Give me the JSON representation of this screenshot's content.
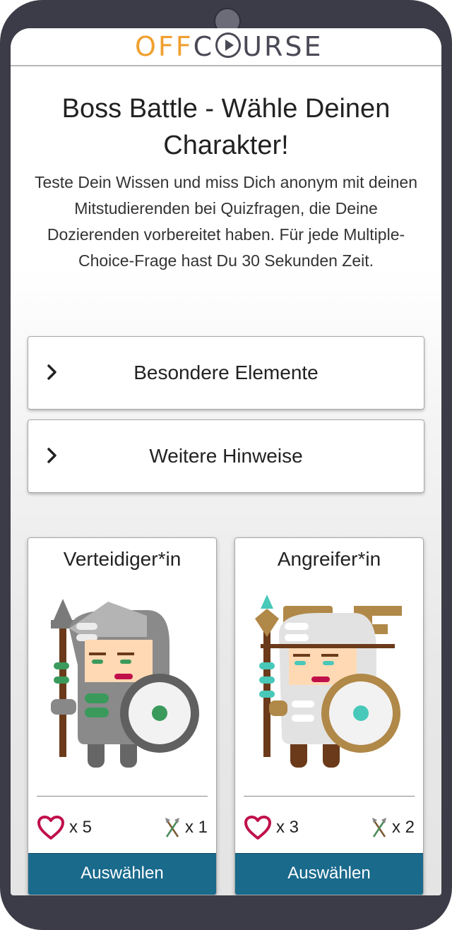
{
  "logo": {
    "part1": "OFF",
    "part2a": "C",
    "part2b": "URSE"
  },
  "page": {
    "title": "Boss Battle - Wähle Deinen Charakter!",
    "description": "Teste Dein Wissen und miss Dich anonym mit deinen Mitstudierenden bei Quizfragen, die Deine Dozierenden vorbereitet haben. Für jede Multiple-Choice-Frage hast Du 30 Sekunden Zeit."
  },
  "accordions": [
    {
      "label": "Besondere Elemente",
      "icon": "chevron-right-icon"
    },
    {
      "label": "Weitere Hinweise",
      "icon": "chevron-right-icon"
    }
  ],
  "characters": [
    {
      "name": "Verteidiger*in",
      "hearts": "x 5",
      "attack": "x 1",
      "button": "Auswählen",
      "accent": "#3a9a5c"
    },
    {
      "name": "Angreifer*in",
      "hearts": "x 3",
      "attack": "x 2",
      "button": "Auswählen",
      "accent": "#48c8b8"
    }
  ],
  "colors": {
    "primary_button": "#1a6a8c",
    "heart": "#c0104a",
    "logo_orange": "#f0a030",
    "logo_gray": "#4a4a56"
  }
}
